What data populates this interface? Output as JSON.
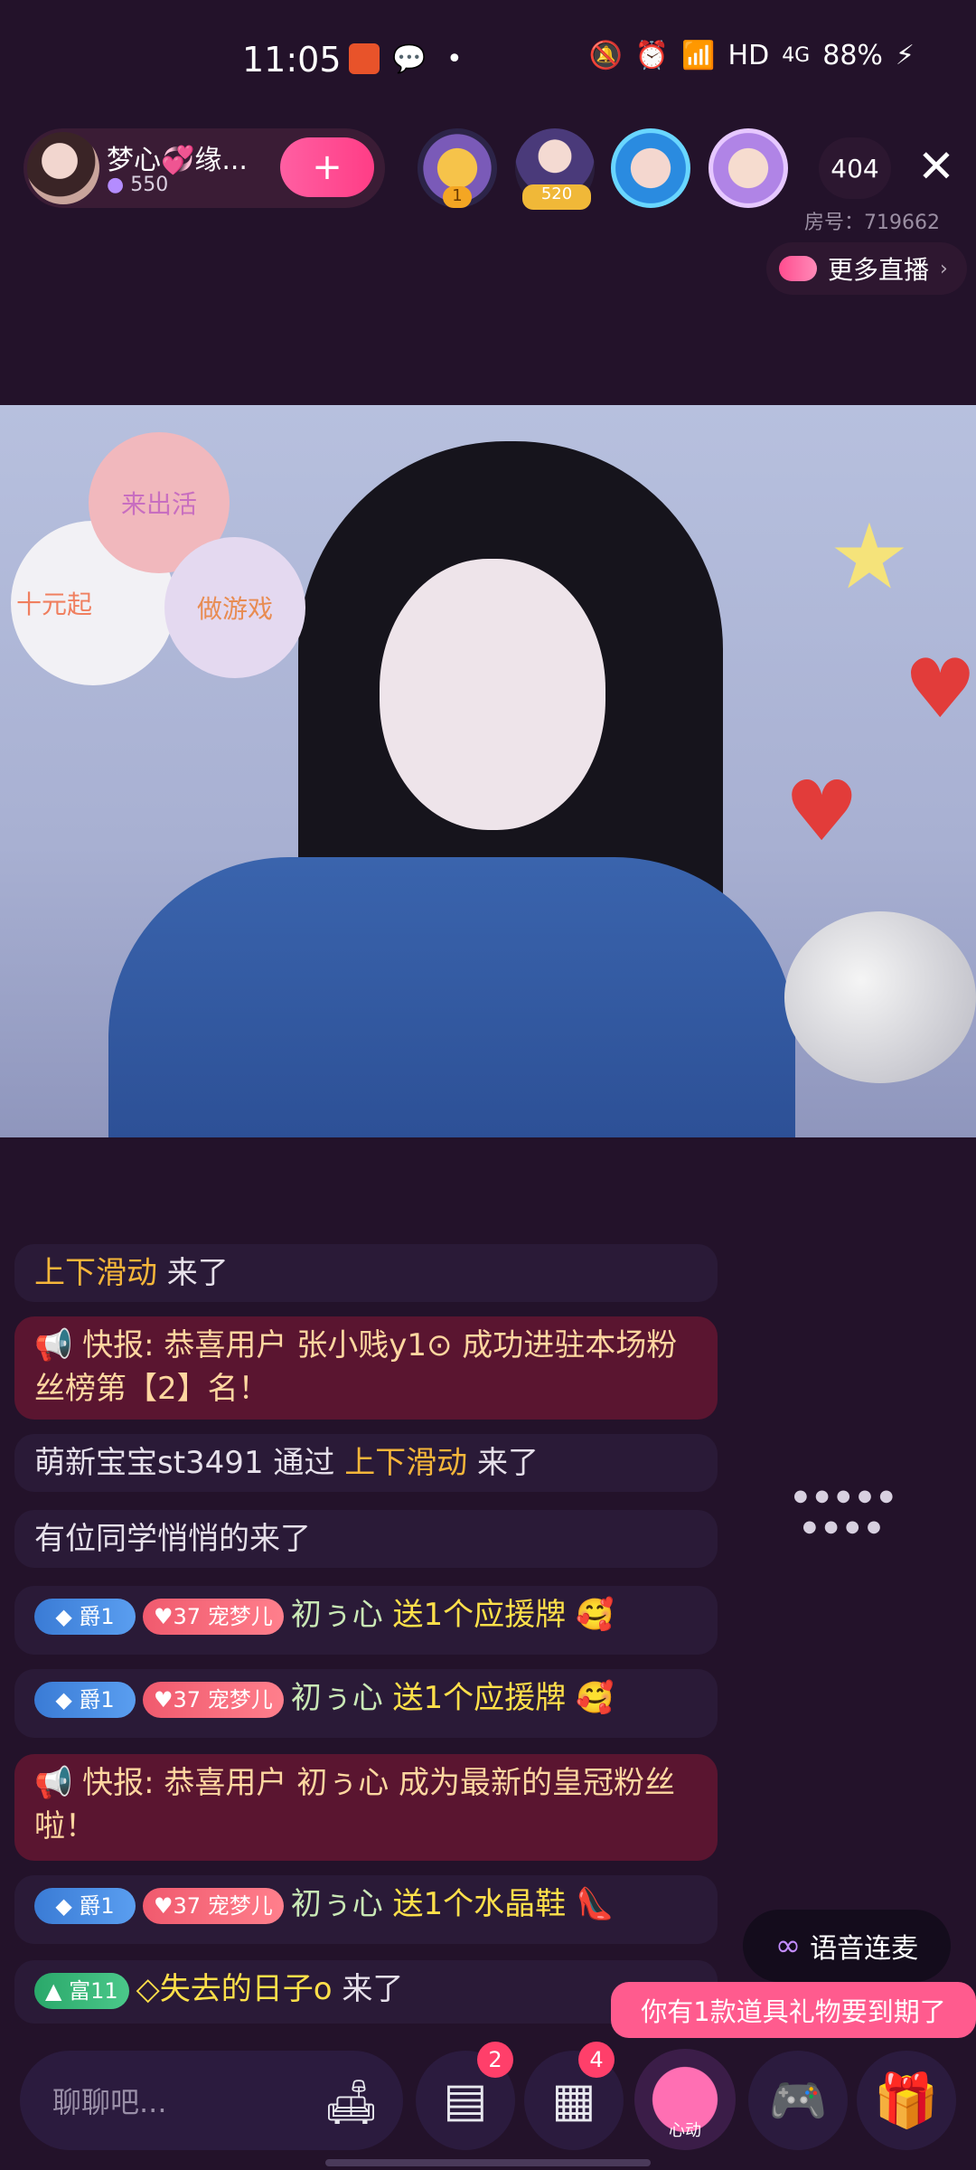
{
  "status_bar": {
    "time": "11:05",
    "network_label": "HD",
    "signal_label": "4G",
    "battery": "88%"
  },
  "header": {
    "host_name": "梦心💞缘...",
    "host_fans": "550",
    "follow_icon": "+",
    "viewer_badges": [
      "1",
      "520"
    ],
    "viewer_count": "404",
    "room_no": "房号：719662",
    "more_live": "更多直播",
    "close_icon": "✕"
  },
  "video": {
    "balloon_texts": [
      "来出活",
      "十元起",
      "做游戏"
    ]
  },
  "chat": {
    "messages": [
      {
        "type": "plain",
        "highlight": "上下滑动",
        "text": " 来了"
      },
      {
        "type": "announce",
        "prefix": "快报: ",
        "text": "恭喜用户 张小贱y1⊙ 成功进驻本场粉丝榜第【2】名！"
      },
      {
        "type": "plain_full",
        "pre": "萌新宝宝st3491 通过 ",
        "highlight": "上下滑动",
        "post": " 来了"
      },
      {
        "type": "plain_text",
        "text": "有位同学悄悄的来了"
      },
      {
        "type": "gift",
        "rank": "爵1",
        "pet": "宠梦儿",
        "pet_level": "37",
        "user": "初ぅ心",
        "gift": " 送1个应援牌",
        "emoji": "🥰"
      },
      {
        "type": "gift",
        "rank": "爵1",
        "pet": "宠梦儿",
        "pet_level": "37",
        "user": "初ぅ心",
        "gift": " 送1个应援牌",
        "emoji": "🥰"
      },
      {
        "type": "announce",
        "prefix": "快报: ",
        "text": "恭喜用户 初ぅ心 成为最新的皇冠粉丝啦！"
      },
      {
        "type": "gift",
        "rank": "爵1",
        "pet": "宠梦儿",
        "pet_level": "37",
        "user": "初ぅ心",
        "gift": " 送1个水晶鞋",
        "emoji": "👠"
      },
      {
        "type": "rich",
        "rank": "富11",
        "user": "◇失去的日子o",
        "text": " 来了"
      }
    ]
  },
  "side": {
    "voice_link": "语音连麦",
    "voice_icon": "link-icon",
    "prop_tip": "你有1款道具礼物要到期了"
  },
  "bottom_bar": {
    "chat_placeholder": "聊聊吧...",
    "msg_badge": "2",
    "grid_badge": "4",
    "heart_label": "心动"
  },
  "colors": {
    "background": "#23122a",
    "accent_pink": "#ff3d86",
    "highlight_orange": "#f6b63a",
    "announce_bg": "#5a1530"
  }
}
